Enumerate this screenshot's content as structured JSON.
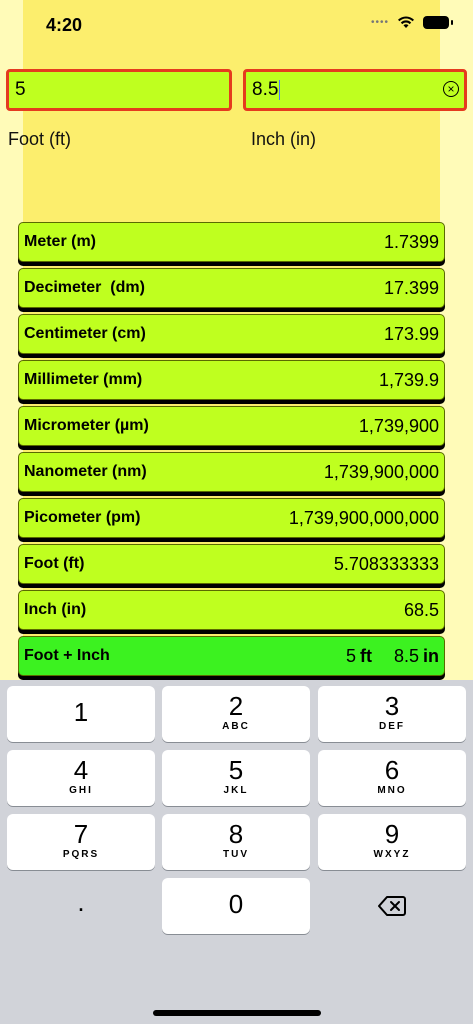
{
  "status": {
    "time": "4:20"
  },
  "inputs": {
    "foot_value": "5",
    "foot_label": "Foot (ft)",
    "inch_value": "8.5",
    "inch_label": "Inch (in)"
  },
  "results": [
    {
      "name": "Meter (m)",
      "value": "1.7399"
    },
    {
      "name": "Decimeter  (dm)",
      "value": "17.399"
    },
    {
      "name": "Centimeter (cm)",
      "value": "173.99"
    },
    {
      "name": "Millimeter (mm)",
      "value": "1,739.9"
    },
    {
      "name": "Micrometer (µm)",
      "value": "1,739,900"
    },
    {
      "name": "Nanometer (nm)",
      "value": "1,739,900,000"
    },
    {
      "name": "Picometer (pm)",
      "value": "1,739,900,000,000"
    },
    {
      "name": "Foot (ft)",
      "value": "5.708333333"
    },
    {
      "name": "Inch (in)",
      "value": "68.5"
    }
  ],
  "foot_inch": {
    "name": "Foot + Inch",
    "feet": "5",
    "feet_unit": "ft",
    "inches": "8.5",
    "inches_unit": "in"
  },
  "keyboard": {
    "k1": {
      "num": "1",
      "letters": ""
    },
    "k2": {
      "num": "2",
      "letters": "ABC"
    },
    "k3": {
      "num": "3",
      "letters": "DEF"
    },
    "k4": {
      "num": "4",
      "letters": "GHI"
    },
    "k5": {
      "num": "5",
      "letters": "JKL"
    },
    "k6": {
      "num": "6",
      "letters": "MNO"
    },
    "k7": {
      "num": "7",
      "letters": "PQRS"
    },
    "k8": {
      "num": "8",
      "letters": "TUV"
    },
    "k9": {
      "num": "9",
      "letters": "WXYZ"
    },
    "k0": {
      "num": "0"
    },
    "dot": "."
  },
  "colors": {
    "background": "#fffbb8",
    "band": "#fcee6d",
    "row": "#bfff1f",
    "highlight_row": "#3cf220",
    "input_border": "#e53b1e"
  }
}
